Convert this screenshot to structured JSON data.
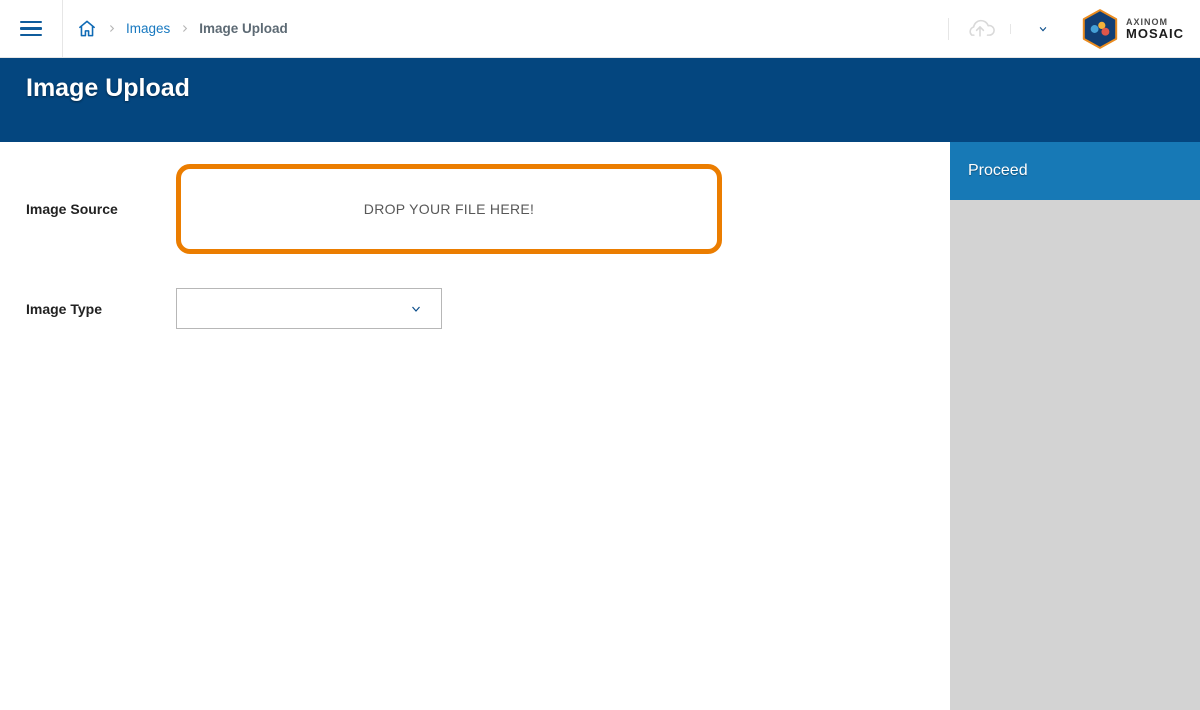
{
  "breadcrumbs": {
    "link1": "Images",
    "current": "Image Upload"
  },
  "brand": {
    "line1": "AXINOM",
    "line2": "MOSAIC"
  },
  "page": {
    "title": "Image Upload"
  },
  "form": {
    "image_source_label": "Image Source",
    "dropzone_text": "DROP YOUR FILE HERE!",
    "image_type_label": "Image Type",
    "image_type_value": ""
  },
  "actions": {
    "proceed": "Proceed"
  }
}
